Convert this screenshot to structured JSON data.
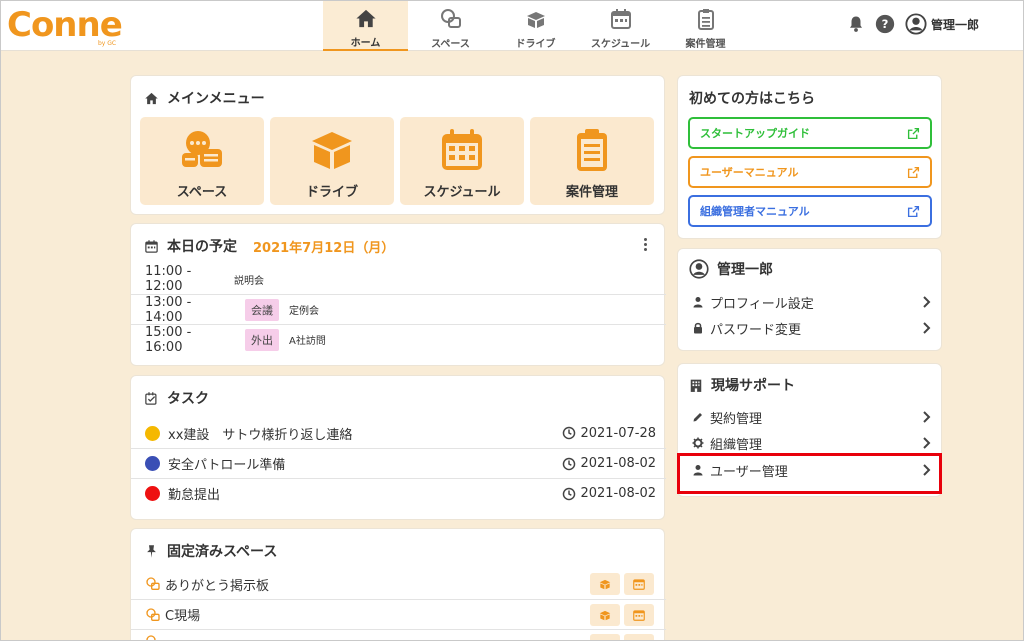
{
  "header": {
    "logo": "Conne",
    "logo_by": "by GC",
    "nav": [
      {
        "label": "ホーム",
        "icon": "home-icon"
      },
      {
        "label": "スペース",
        "icon": "space-icon"
      },
      {
        "label": "ドライブ",
        "icon": "drive-box-icon"
      },
      {
        "label": "スケジュール",
        "icon": "calendar-icon"
      },
      {
        "label": "案件管理",
        "icon": "clipboard-icon"
      }
    ],
    "user_name": "管理一郎"
  },
  "main_menu": {
    "title": "メインメニュー",
    "tiles": [
      {
        "label": "スペース",
        "icon": "space-chat-icon"
      },
      {
        "label": "ドライブ",
        "icon": "drive-box-icon"
      },
      {
        "label": "スケジュール",
        "icon": "calendar-icon"
      },
      {
        "label": "案件管理",
        "icon": "clipboard-icon"
      }
    ]
  },
  "today": {
    "title": "本日の予定",
    "date": "2021年7月12日（月）",
    "events": [
      {
        "time": "11:00 - 12:00",
        "tag": "",
        "title": "説明会"
      },
      {
        "time": "13:00 - 14:00",
        "tag": "会議",
        "title": "定例会"
      },
      {
        "time": "15:00 - 16:00",
        "tag": "外出",
        "title": "A社訪問"
      }
    ]
  },
  "tasks": {
    "title": "タスク",
    "items": [
      {
        "name": "xx建設　サトウ様折り返し連絡",
        "date": "2021-07-28",
        "color": "#f5b800"
      },
      {
        "name": "安全パトロール準備",
        "date": "2021-08-02",
        "color": "#3a4fb5"
      },
      {
        "name": "勤怠提出",
        "date": "2021-08-02",
        "color": "#ee1111"
      }
    ]
  },
  "pinned": {
    "title": "固定済みスペース",
    "items": [
      {
        "name": "ありがとう掲示板"
      },
      {
        "name": "C現場"
      },
      {
        "name": ""
      }
    ]
  },
  "first_time": {
    "title": "初めての方はこちら",
    "links": [
      {
        "label": "スタートアップガイド",
        "color": "#2fbf3a"
      },
      {
        "label": "ユーザーマニュアル",
        "color": "#f0961e"
      },
      {
        "label": "組織管理者マニュアル",
        "color": "#3b6fe0"
      }
    ]
  },
  "profile": {
    "title": "管理一郎",
    "links": [
      {
        "label": "プロフィール設定",
        "icon": "person-icon"
      },
      {
        "label": "パスワード変更",
        "icon": "lock-icon"
      }
    ]
  },
  "site_support": {
    "title": "現場サポート",
    "links": [
      {
        "label": "契約管理",
        "icon": "pencil-icon"
      },
      {
        "label": "組織管理",
        "icon": "gear-icon"
      },
      {
        "label": "ユーザー管理",
        "icon": "person-icon"
      }
    ]
  },
  "colors": {
    "accent": "#f0961e",
    "background": "#f9ecd6",
    "highlight": "#e8000b"
  }
}
